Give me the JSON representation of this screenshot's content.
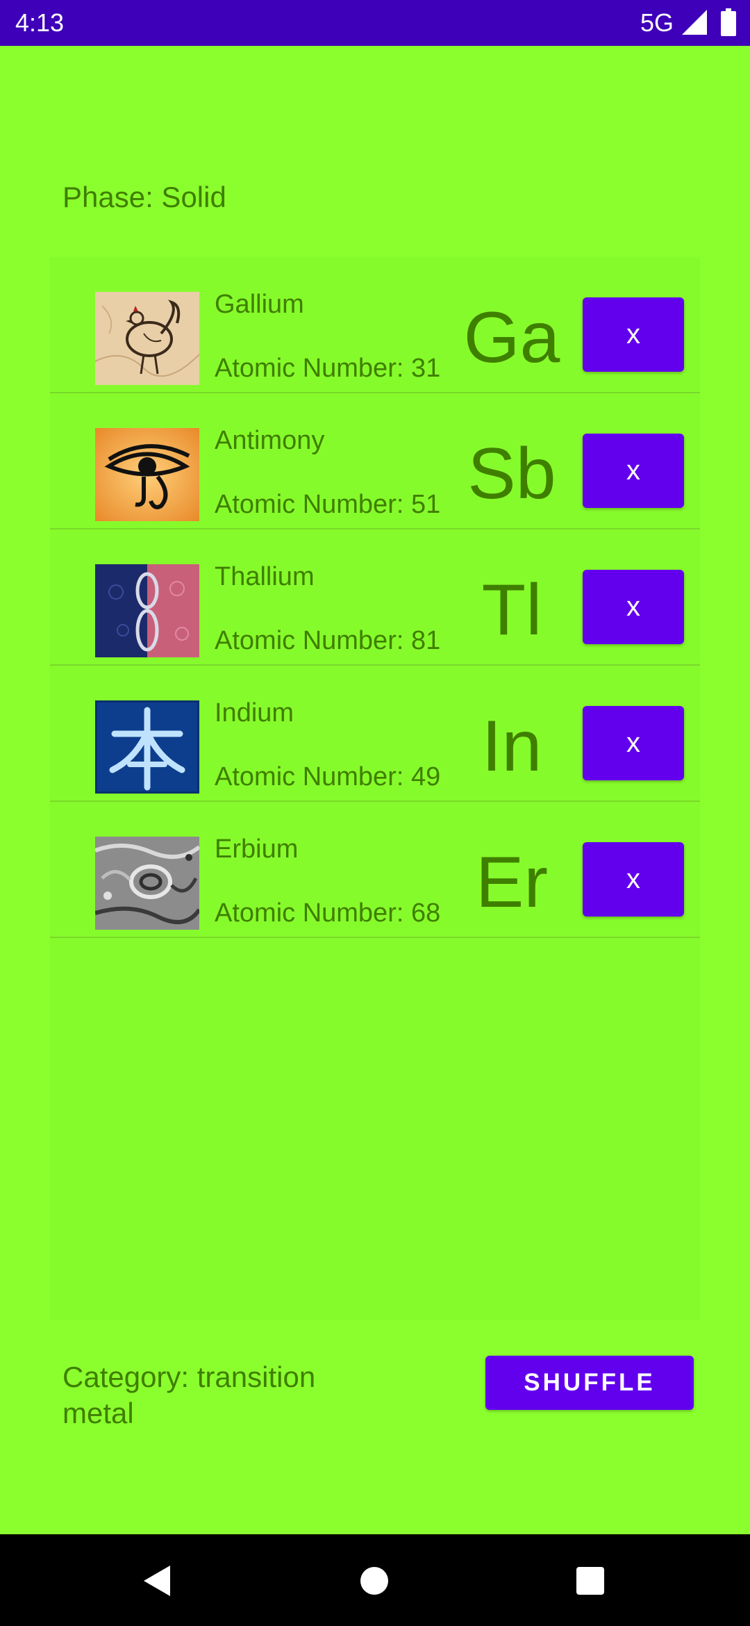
{
  "status_bar": {
    "time": "4:13",
    "network": "5G",
    "icons": [
      "signal-icon",
      "battery-icon"
    ]
  },
  "phase": "Phase: Solid",
  "elements": [
    {
      "name": "Gallium",
      "atomic_label": "Atomic Number: ",
      "atomic_number": "31",
      "symbol": "Ga",
      "remove_label": "x",
      "image": "rooster-image"
    },
    {
      "name": "Antimony",
      "atomic_label": "Atomic Number: ",
      "atomic_number": "51",
      "symbol": "Sb",
      "remove_label": "x",
      "image": "eye-of-horus-image"
    },
    {
      "name": "Thallium",
      "atomic_label": "Atomic Number: ",
      "atomic_number": "81",
      "symbol": "Tl",
      "remove_label": "x",
      "image": "infinity-knot-image"
    },
    {
      "name": "Indium",
      "atomic_label": "Atomic Number: ",
      "atomic_number": "49",
      "symbol": "In",
      "remove_label": "x",
      "image": "kanji-image"
    },
    {
      "name": "Erbium",
      "atomic_label": "Atomic Number: ",
      "atomic_number": "68",
      "symbol": "Er",
      "remove_label": "x",
      "image": "metal-emblem-image"
    }
  ],
  "category": "Category: transition metal",
  "shuffle_label": "SHUFFLE",
  "nav_bar": {
    "icons": [
      "back-icon",
      "home-icon",
      "recents-icon"
    ]
  },
  "colors": {
    "background": "#8bff2e",
    "status_bar": "#3e00b8",
    "accent": "#6200ee",
    "text": "#3f7f00"
  }
}
